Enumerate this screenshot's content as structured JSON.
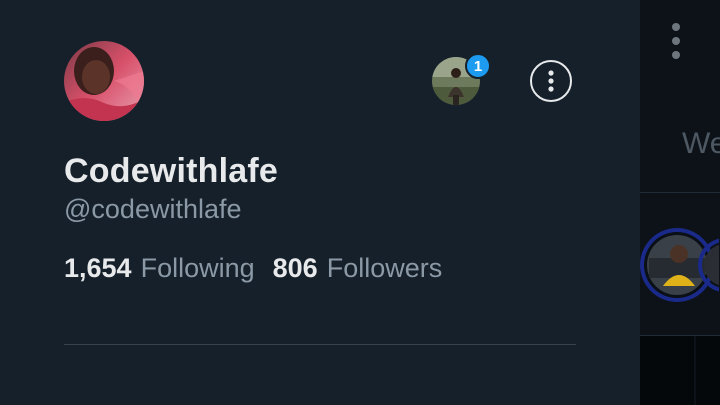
{
  "profile": {
    "display_name": "Codewithlafe",
    "handle": "@codewithlafe",
    "avatar_icon": "profile-photo",
    "following_count": "1,654",
    "following_label": "Following",
    "followers_count": "806",
    "followers_label": "Followers"
  },
  "account_switcher": {
    "badge_count": "1"
  },
  "background": {
    "partial_text": "We"
  },
  "colors": {
    "background": "#15202b",
    "primary_text": "#e7e9ea",
    "secondary_text": "#8b98a5",
    "accent": "#1d9bf0",
    "divider": "#38444d"
  }
}
